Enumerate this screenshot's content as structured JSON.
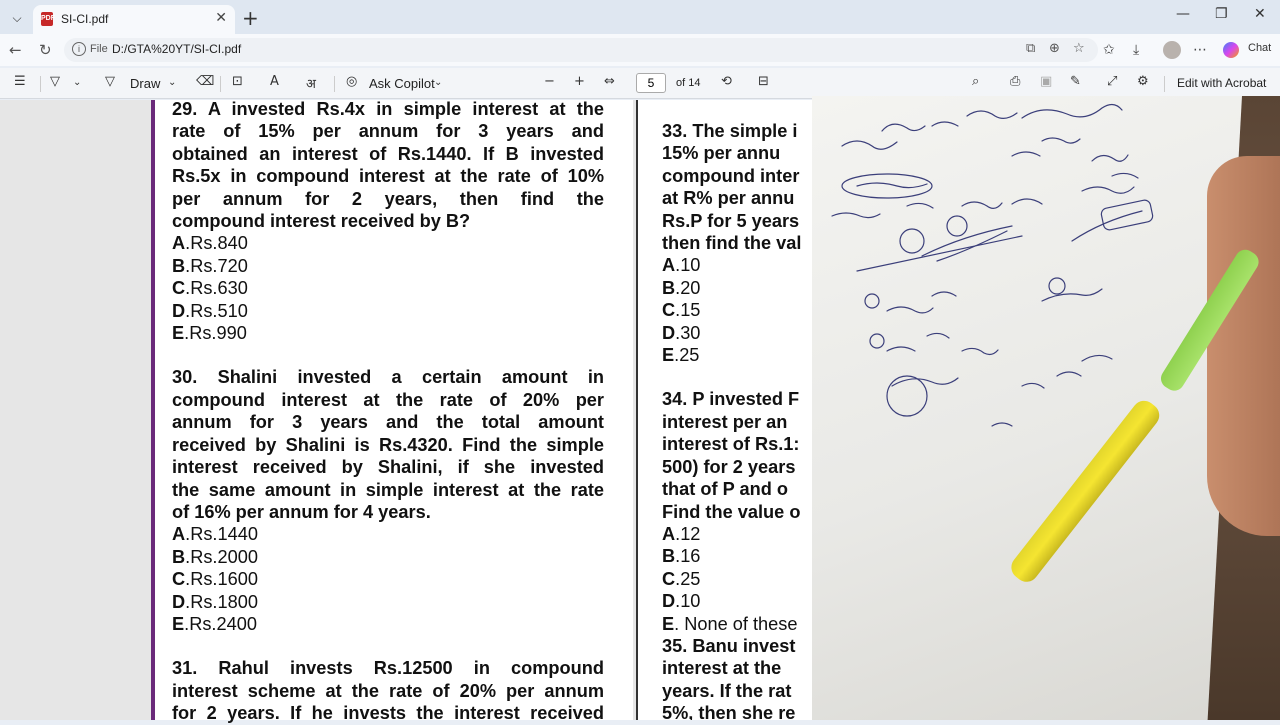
{
  "browser": {
    "tab": {
      "title": "SI-CI.pdf",
      "icon": "pdf-icon",
      "close": "✕"
    },
    "new_tab": "+",
    "window_controls": {
      "minimize": "—",
      "maximize": "❐",
      "close": "✕"
    },
    "address": {
      "scheme_label": "File",
      "url": "D:/GTA%20YT/SI-CI.pdf"
    },
    "chat_label": "Chat"
  },
  "pdf_toolbar": {
    "draw_label": "Draw",
    "ask_copilot_label": "Ask Copilot",
    "current_page": "5",
    "page_count_label": "of 14",
    "edit_with_acrobat_label": "Edit with Acrobat"
  },
  "page_left": {
    "q29": {
      "lines": [
        "29. A invested Rs.4x in simple interest at the",
        "rate of 15% per annum for 3 years and",
        "obtained an interest of Rs.1440. If B invested",
        "Rs.5x in compound interest at the rate of 10%",
        "per annum for 2 years, then find the",
        "compound interest received by B?"
      ],
      "options": [
        {
          "letter": "A",
          "text": ".Rs.840"
        },
        {
          "letter": "B",
          "text": ".Rs.720"
        },
        {
          "letter": "C",
          "text": ".Rs.630"
        },
        {
          "letter": "D",
          "text": ".Rs.510"
        },
        {
          "letter": "E",
          "text": ".Rs.990"
        }
      ]
    },
    "q30": {
      "lines": [
        "30. Shalini invested a certain amount in",
        "compound interest at the rate of 20% per",
        "annum for 3 years and the total amount",
        "received by Shalini is Rs.4320. Find the simple",
        "interest received by Shalini, if she invested",
        "the same amount in simple interest at the rate",
        "of 16% per annum for 4 years."
      ],
      "options": [
        {
          "letter": "A",
          "text": ".Rs.1440"
        },
        {
          "letter": "B",
          "text": ".Rs.2000"
        },
        {
          "letter": "C",
          "text": ".Rs.1600"
        },
        {
          "letter": "D",
          "text": ".Rs.1800"
        },
        {
          "letter": "E",
          "text": ".Rs.2400"
        }
      ]
    },
    "q31": {
      "lines": [
        "31. Rahul invests Rs.12500 in compound",
        "interest scheme at the rate of 20% per annum",
        "for 2 years. If he invests the interest received"
      ]
    }
  },
  "page_right": {
    "q33": {
      "lines": [
        "33. The simple i",
        "15% per annu",
        "compound inter",
        "at R% per annu",
        "Rs.P for 5 years",
        "then find the val"
      ],
      "options": [
        {
          "letter": "A",
          "text": ".10"
        },
        {
          "letter": "B",
          "text": ".20"
        },
        {
          "letter": "C",
          "text": ".15"
        },
        {
          "letter": "D",
          "text": ".30"
        },
        {
          "letter": "E",
          "text": ".25"
        }
      ]
    },
    "q34": {
      "lines": [
        "34. P invested F",
        "interest per an",
        "interest of Rs.1:",
        "500) for 2 years",
        "that of P and o",
        "Find the value o"
      ],
      "options": [
        {
          "letter": "A",
          "text": ".12"
        },
        {
          "letter": "B",
          "text": ".16"
        },
        {
          "letter": "C",
          "text": ".25"
        },
        {
          "letter": "D",
          "text": ".10"
        },
        {
          "letter": "E",
          "text": ". None of these"
        }
      ]
    },
    "q35": {
      "lines": [
        "35. Banu invest",
        "interest at the",
        "years. If the rat",
        "5%, then she re"
      ]
    }
  },
  "colors": {
    "accent_purple": "#6a2a7a",
    "highlighter": "#f5e531"
  }
}
